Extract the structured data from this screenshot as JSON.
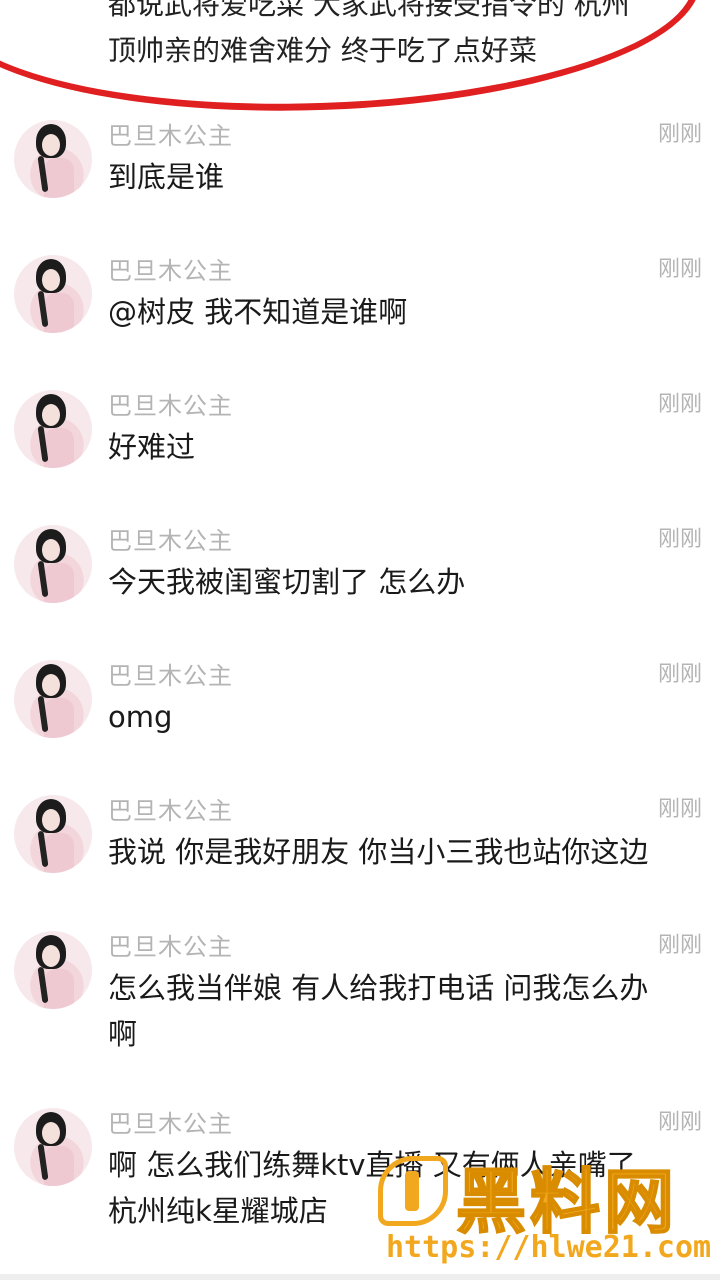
{
  "top_message": {
    "line1": "都说武将爱吃菜 大家武将接受指令的 杭州",
    "line2": "顶帅亲的难舍难分 终于吃了点好菜"
  },
  "comments": [
    {
      "user": "巴旦木公主",
      "time": "刚刚",
      "text": [
        "到底是谁"
      ]
    },
    {
      "user": "巴旦木公主",
      "time": "刚刚",
      "text": [
        "@树皮 我不知道是谁啊"
      ]
    },
    {
      "user": "巴旦木公主",
      "time": "刚刚",
      "text": [
        "好难过"
      ]
    },
    {
      "user": "巴旦木公主",
      "time": "刚刚",
      "text": [
        "今天我被闺蜜切割了 怎么办"
      ]
    },
    {
      "user": "巴旦木公主",
      "time": "刚刚",
      "text": [
        "omg"
      ]
    },
    {
      "user": "巴旦木公主",
      "time": "刚刚",
      "text": [
        "我说 你是我好朋友 你当小三我也站你这边"
      ]
    },
    {
      "user": "巴旦木公主",
      "time": "刚刚",
      "text": [
        "怎么我当伴娘 有人给我打电话 问我怎么办",
        "啊"
      ]
    },
    {
      "user": "巴旦木公主",
      "time": "刚刚",
      "text": [
        "啊 怎么我们练舞ktv直播 又有俩人亲嘴了",
        "杭州纯k星耀城店"
      ]
    }
  ],
  "watermark": {
    "title": "黑料网",
    "url": "https://hlwe21.com"
  }
}
